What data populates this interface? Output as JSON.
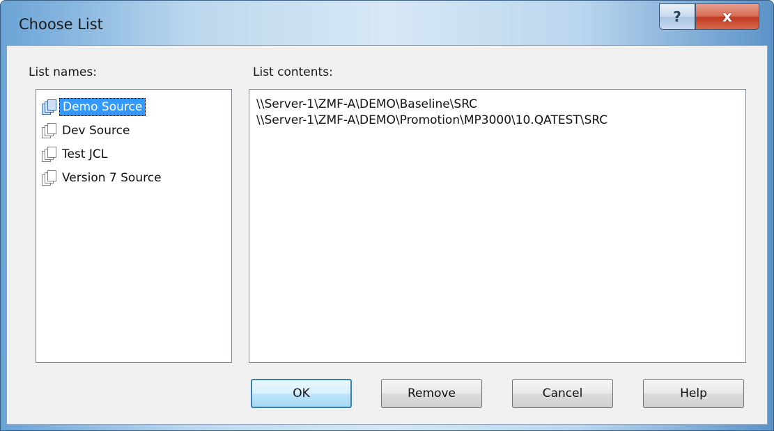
{
  "window": {
    "title": "Choose List",
    "help_glyph": "?",
    "close_glyph": "x"
  },
  "list_names": {
    "label": "List names:",
    "items": [
      "Demo Source",
      "Dev Source",
      "Test JCL",
      "Version 7 Source"
    ],
    "selected": "Demo Source"
  },
  "list_contents": {
    "label": "List contents:",
    "lines": [
      "\\\\Server-1\\ZMF-A\\DEMO\\Baseline\\SRC",
      "\\\\Server-1\\ZMF-A\\DEMO\\Promotion\\MP3000\\10.QATEST\\SRC"
    ]
  },
  "buttons": {
    "ok": "OK",
    "remove": "Remove",
    "cancel": "Cancel",
    "help": "Help"
  }
}
